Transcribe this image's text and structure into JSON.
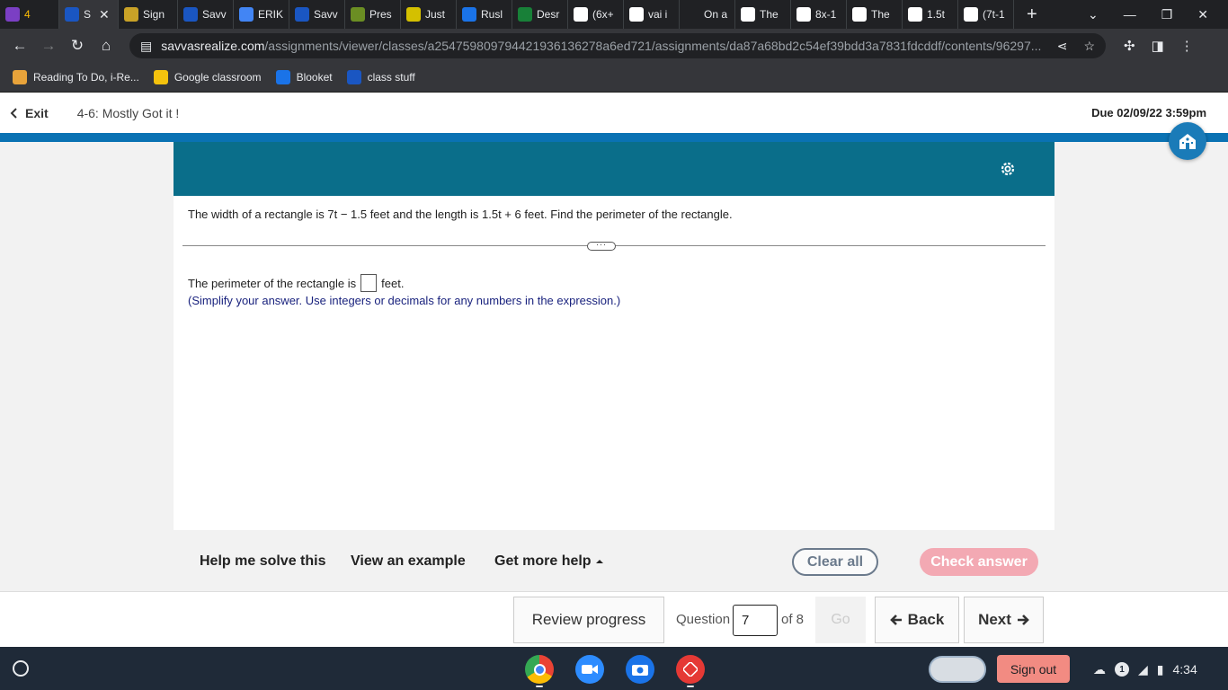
{
  "browser": {
    "tabs": [
      {
        "label": "",
        "badge": "4",
        "color": "#7b3fc4",
        "icon": "classroom-icon"
      },
      {
        "label": "S",
        "color": "#1a56c2",
        "icon": "savvas-icon",
        "active": true
      },
      {
        "label": "Sign",
        "color": "#c9a227",
        "icon": "docs-icon"
      },
      {
        "label": "Savv",
        "color": "#1a56c2",
        "icon": "savvas-icon"
      },
      {
        "label": "ERIK",
        "color": "#4285f4",
        "icon": "docs-icon"
      },
      {
        "label": "Savv",
        "color": "#1a56c2",
        "icon": "savvas-icon"
      },
      {
        "label": "Pres",
        "color": "#6b8e23",
        "icon": "site-icon"
      },
      {
        "label": "Just",
        "color": "#d4c000",
        "icon": "u-icon"
      },
      {
        "label": "Rusl",
        "color": "#1a73e8",
        "icon": "site-icon"
      },
      {
        "label": "Desr",
        "color": "#188038",
        "icon": "site-icon"
      },
      {
        "label": "(6x+",
        "color": "#ffffff",
        "icon": "google-icon"
      },
      {
        "label": "vai i",
        "color": "#ffffff",
        "icon": "google-icon"
      },
      {
        "label": "On a",
        "color": "#202124",
        "icon": "b-icon"
      },
      {
        "label": "The",
        "color": "#ffffff",
        "icon": "google-icon"
      },
      {
        "label": "8x-1",
        "color": "#ffffff",
        "icon": "google-icon"
      },
      {
        "label": "The",
        "color": "#ffffff",
        "icon": "google-icon"
      },
      {
        "label": "1.5t",
        "color": "#ffffff",
        "icon": "google-icon"
      },
      {
        "label": "(7t-1",
        "color": "#ffffff",
        "icon": "google-icon"
      }
    ],
    "url_domain": "savvasrealize.com",
    "url_path": "/assignments/viewer/classes/a254759809794421936136278a6ed721/assignments/da87a68bd2c54ef39bdd3a7831fdcddf/contents/96297...",
    "bookmarks": [
      {
        "label": "Reading To Do, i-Re...",
        "icon": "cube-icon",
        "color": "#e8a33a"
      },
      {
        "label": "Google classroom",
        "icon": "classroom-icon",
        "color": "#f4c20d"
      },
      {
        "label": "Blooket",
        "icon": "blooket-icon",
        "color": "#1a73e8"
      },
      {
        "label": "class stuff",
        "icon": "folder-66-icon",
        "color": "#1a56c2"
      }
    ]
  },
  "header": {
    "exit_label": "Exit",
    "assignment_title": "4-6: Mostly Got it !",
    "due": "Due 02/09/22 3:59pm"
  },
  "question": {
    "prompt": "The width of a rectangle is 7t − 1.5 feet and the length is 1.5t + 6 feet. Find the perimeter of the rectangle.",
    "expand_label": "···",
    "answer_prefix": "The perimeter of the rectangle is",
    "answer_suffix": "feet.",
    "hint": "(Simplify your answer. Use integers or decimals for any numbers in the expression.)"
  },
  "help": {
    "help_me_solve": "Help me solve this",
    "view_example": "View an example",
    "more_help": "Get more help",
    "clear_all": "Clear all",
    "check_answer": "Check answer"
  },
  "footer": {
    "review_progress": "Review progress",
    "question_label": "Question",
    "question_number": "7",
    "of_label": "of 8",
    "go_label": "Go",
    "back_label": "Back",
    "next_label": "Next"
  },
  "shelf": {
    "sign_out": "Sign out",
    "notification_count": "1",
    "time": "4:34"
  },
  "colors": {
    "banner": "#0a6e8a",
    "accent_blue": "#0a72b3",
    "check_answer_disabled": "#f3a9b3",
    "hint_text": "#1a237e"
  }
}
